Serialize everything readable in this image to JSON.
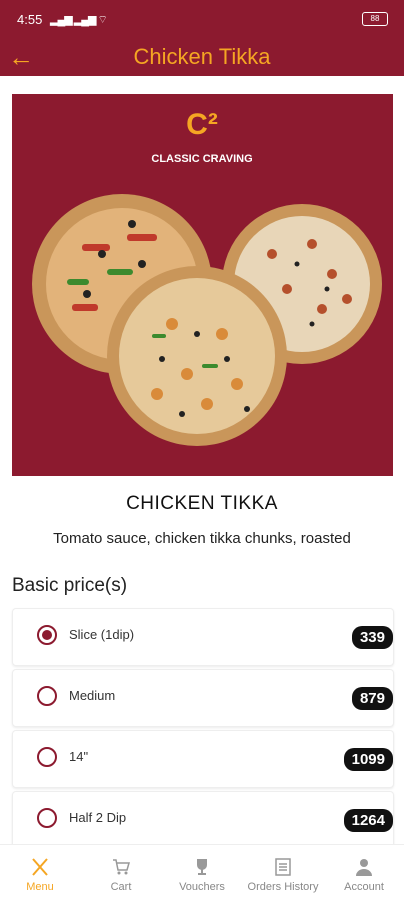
{
  "status": {
    "time": "4:55",
    "battery": "88"
  },
  "header": {
    "title": "Chicken Tikka"
  },
  "hero": {
    "brand_mark": "C²",
    "brand_text": "CLASSIC CRAVING"
  },
  "product": {
    "name": "CHICKEN TIKKA",
    "description": "Tomato sauce, chicken tikka chunks, roasted"
  },
  "section_title": "Basic price(s)",
  "options": [
    {
      "label": "Slice (1dip)",
      "price": "339",
      "selected": true
    },
    {
      "label": "Medium",
      "price": "879",
      "selected": false
    },
    {
      "label": "14\"",
      "price": "1099",
      "selected": false
    },
    {
      "label": "Half 2 Dip",
      "price": "1264",
      "selected": false
    }
  ],
  "nav": [
    {
      "label": "Menu",
      "icon": "fork-knife-icon",
      "active": true
    },
    {
      "label": "Cart",
      "icon": "cart-icon",
      "active": false
    },
    {
      "label": "Vouchers",
      "icon": "trophy-icon",
      "active": false
    },
    {
      "label": "Orders History",
      "icon": "list-icon",
      "active": false
    },
    {
      "label": "Account",
      "icon": "user-icon",
      "active": false
    }
  ],
  "colors": {
    "primary": "#8c1a2f",
    "accent": "#f5a623"
  }
}
